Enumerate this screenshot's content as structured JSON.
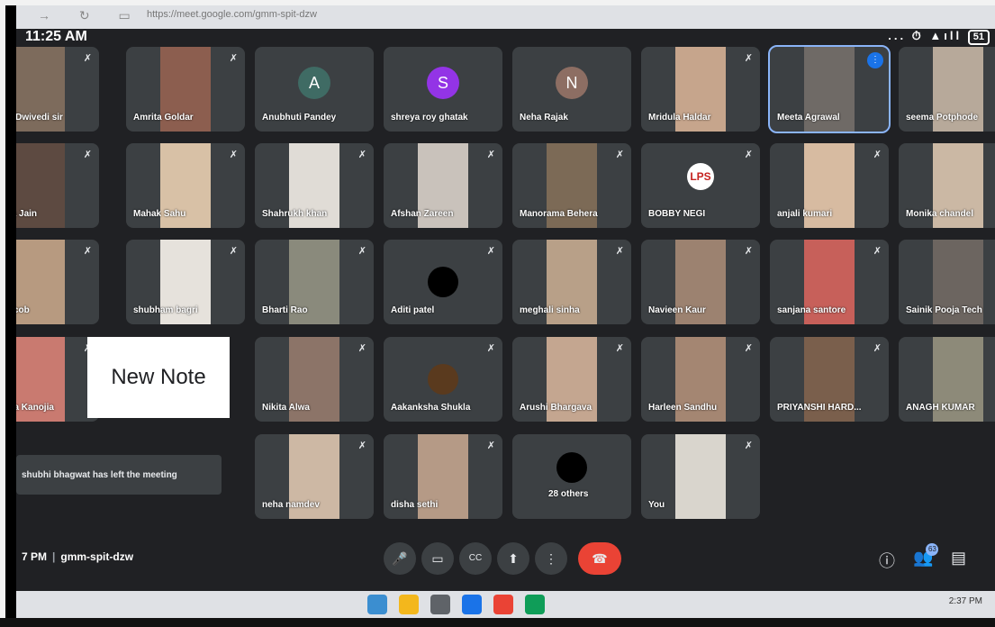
{
  "browser": {
    "url": "https://meet.google.com/gmm-spit-dzw"
  },
  "status": {
    "time": "11:25 AM",
    "icons": "... ⏱ ▲ıll",
    "battery": "51"
  },
  "participants": [
    {
      "name": "eepak Dwivedi sir",
      "type": "video",
      "bg": "#7d6b5c"
    },
    {
      "name": "Amrita Goldar",
      "type": "video",
      "bg": "#8c5e4f"
    },
    {
      "name": "Anubhuti Pandey",
      "type": "avatar",
      "initial": "A",
      "color": "#3f6b64"
    },
    {
      "name": "shreya roy ghatak",
      "type": "avatar",
      "initial": "S",
      "color": "#9334e6"
    },
    {
      "name": "Neha Rajak",
      "type": "avatar",
      "initial": "N",
      "color": "#8d6e63"
    },
    {
      "name": "Mridula Haldar",
      "type": "video",
      "bg": "#c6a58c"
    },
    {
      "name": "Meeta Agrawal",
      "type": "video",
      "bg": "#6f6a66",
      "active": true
    },
    {
      "name": "seema Potphode",
      "type": "video",
      "bg": "#b7a99a"
    },
    {
      "name": "oumya Jain",
      "type": "video",
      "bg": "#5d4a41"
    },
    {
      "name": "Mahak Sahu",
      "type": "video",
      "bg": "#d8c1a6"
    },
    {
      "name": "Shahrukh khan",
      "type": "video",
      "bg": "#e0dcd6"
    },
    {
      "name": "Afshan Zareen",
      "type": "video",
      "bg": "#c9c2bb"
    },
    {
      "name": "Manorama Behera",
      "type": "video",
      "bg": "#7c6a56"
    },
    {
      "name": "BOBBY NEGI",
      "type": "logo",
      "logo": "LPS"
    },
    {
      "name": "anjali kumari",
      "type": "video",
      "bg": "#d7bba1"
    },
    {
      "name": "Monika chandel",
      "type": "video",
      "bg": "#cbb8a4"
    },
    {
      "name": "dhi Jacob",
      "type": "video",
      "bg": "#b79a80"
    },
    {
      "name": "shubham bagri",
      "type": "video",
      "bg": "#e6e2dc"
    },
    {
      "name": "Bharti Rao",
      "type": "video",
      "bg": "#8a8a7c"
    },
    {
      "name": "Aditi patel",
      "type": "dark"
    },
    {
      "name": "meghali sinha",
      "type": "video",
      "bg": "#b8a088"
    },
    {
      "name": "Navieen Kaur",
      "type": "video",
      "bg": "#9c8270"
    },
    {
      "name": "sanjana santore",
      "type": "video",
      "bg": "#c7605a"
    },
    {
      "name": "Sainik Pooja Tech",
      "type": "video",
      "bg": "#6c6560"
    },
    {
      "name": "riyanka Kanojia",
      "type": "video",
      "bg": "#c97a70"
    },
    {
      "name": "",
      "type": "hidden"
    },
    {
      "name": "Nikita Alwa",
      "type": "video",
      "bg": "#8c7468"
    },
    {
      "name": "Aakanksha Shukla",
      "type": "dark2"
    },
    {
      "name": "Arushi Bhargava",
      "type": "video",
      "bg": "#c4a690"
    },
    {
      "name": "Harleen Sandhu",
      "type": "video",
      "bg": "#a48672"
    },
    {
      "name": "PRIYANSHI HARD...",
      "type": "video",
      "bg": "#7a5f4c"
    },
    {
      "name": "ANAGH KUMAR",
      "type": "video",
      "bg": "#8d8a79"
    },
    {
      "name": "neha namdev",
      "type": "video",
      "bg": "#cdb8a4"
    },
    {
      "name": "disha sethi",
      "type": "video",
      "bg": "#b59a86"
    },
    {
      "name": "28 others",
      "type": "others"
    },
    {
      "name": "You",
      "type": "video",
      "bg": "#d9d5cd"
    }
  ],
  "note": {
    "text": "New Note"
  },
  "toast": {
    "text": "shubhi bhagwat has left the meeting"
  },
  "meeting": {
    "time": "7 PM",
    "sep": "|",
    "code": "gmm-spit-dzw"
  },
  "controls": {
    "mic": "🎤",
    "camera": "▭",
    "captions": "CC",
    "present": "⬆",
    "more": "⋮",
    "end": "☎",
    "info": "ⓘ",
    "people": "👥",
    "people_badge": "63",
    "chat": "▤"
  },
  "taskbar": {
    "clock": "2:37 PM"
  },
  "mic_off_glyph": "✗"
}
